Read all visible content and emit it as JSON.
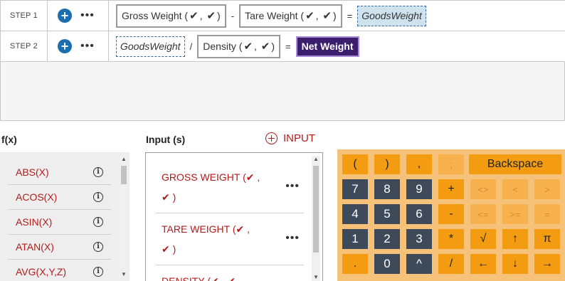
{
  "steps": [
    {
      "label": "STEP 1",
      "chip1": "Gross Weight (",
      "chip1_close": ")",
      "op1": "-",
      "chip2": "Tare Weight (",
      "chip2_close": ")",
      "eq": "=",
      "result": "GoodsWeight"
    },
    {
      "label": "STEP 2",
      "var": "GoodsWeight",
      "op": "/",
      "chip": "Density (",
      "chip_close": ")",
      "eq": "=",
      "result": "Net Weight"
    }
  ],
  "icons": {
    "check": "✔",
    "plus": "+",
    "more": "•••"
  },
  "headers": {
    "functions": "f(x)",
    "inputs": "Input (s)",
    "add_input": "INPUT"
  },
  "functions": [
    "ABS(X)",
    "ACOS(X)",
    "ASIN(X)",
    "ATAN(X)",
    "AVG(X,Y,Z)"
  ],
  "inputs": [
    {
      "line1": "GROSS WEIGHT (",
      "line2": ")"
    },
    {
      "line1": "TARE WEIGHT (",
      "line2": ")"
    },
    {
      "line1": "DENSITY (",
      "line2": ")"
    }
  ],
  "calculator": {
    "row1": [
      "(",
      ")",
      ",",
      ";"
    ],
    "backspace": "Backspace",
    "row2": [
      "7",
      "8",
      "9",
      "+",
      "<>",
      "<",
      ">"
    ],
    "row3": [
      "4",
      "5",
      "6",
      "-",
      "<=",
      ">=",
      "="
    ],
    "row4": [
      "1",
      "2",
      "3",
      "*",
      "√",
      "↑",
      "π"
    ],
    "row5": [
      ".",
      "0",
      "^",
      "/",
      "←",
      "↓",
      "→"
    ]
  },
  "colors": {
    "accent_red": "#b31b1b",
    "keypad_orange": "#f39c12",
    "keypad_dark": "#3e4a59",
    "result_purple": "#3b1f6d",
    "plus_blue": "#1b6fb0"
  }
}
